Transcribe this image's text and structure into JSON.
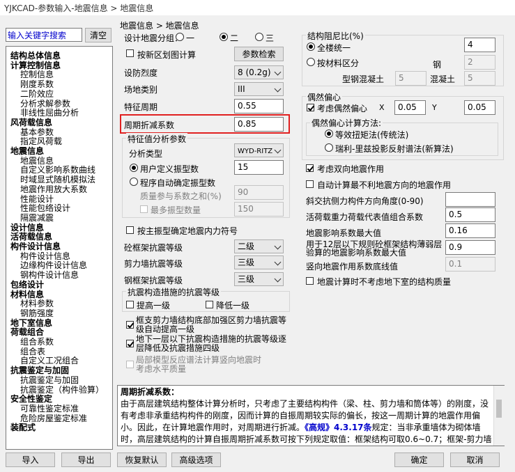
{
  "window": {
    "title": "YJKCAD-参数输入-地震信息 > 地震信息"
  },
  "search": {
    "placeholder": "输入关键字搜索",
    "clear_label": "清空"
  },
  "tree": [
    {
      "label": "结构总体信息",
      "bold": true
    },
    {
      "label": "计算控制信息",
      "bold": true
    },
    {
      "label": "控制信息",
      "bold": false
    },
    {
      "label": "刚度系数",
      "bold": false
    },
    {
      "label": "二阶效应",
      "bold": false
    },
    {
      "label": "分析求解参数",
      "bold": false
    },
    {
      "label": "非线性屈曲分析",
      "bold": false
    },
    {
      "label": "风荷载信息",
      "bold": true
    },
    {
      "label": "基本参数",
      "bold": false
    },
    {
      "label": "指定风荷载",
      "bold": false
    },
    {
      "label": "地震信息",
      "bold": true
    },
    {
      "label": "地震信息",
      "bold": false
    },
    {
      "label": "自定义影响系数曲线",
      "bold": false
    },
    {
      "label": "时域显式随机模拟法",
      "bold": false
    },
    {
      "label": "地震作用放大系数",
      "bold": false
    },
    {
      "label": "性能设计",
      "bold": false
    },
    {
      "label": "性能包络设计",
      "bold": false
    },
    {
      "label": "隔震减震",
      "bold": false
    },
    {
      "label": "设计信息",
      "bold": true
    },
    {
      "label": "活荷载信息",
      "bold": true
    },
    {
      "label": "构件设计信息",
      "bold": true
    },
    {
      "label": "构件设计信息",
      "bold": false
    },
    {
      "label": "边缘构件设计信息",
      "bold": false
    },
    {
      "label": "钢构件设计信息",
      "bold": false
    },
    {
      "label": "包络设计",
      "bold": true
    },
    {
      "label": "材料信息",
      "bold": true
    },
    {
      "label": "材料参数",
      "bold": false
    },
    {
      "label": "钢筋强度",
      "bold": false
    },
    {
      "label": "地下室信息",
      "bold": true
    },
    {
      "label": "荷载组合",
      "bold": true
    },
    {
      "label": "组合系数",
      "bold": false
    },
    {
      "label": "组合表",
      "bold": false
    },
    {
      "label": "自定义工况组合",
      "bold": false
    },
    {
      "label": "抗震鉴定与加固",
      "bold": true
    },
    {
      "label": "抗震鉴定与加固",
      "bold": false
    },
    {
      "label": "抗震鉴定（构件验算）",
      "bold": false
    },
    {
      "label": "安全性鉴定",
      "bold": true
    },
    {
      "label": "可靠性鉴定标准",
      "bold": false
    },
    {
      "label": "危险房屋鉴定标准",
      "bold": false
    },
    {
      "label": "装配式",
      "bold": true
    }
  ],
  "breadcrumb": "地震信息 > 地震信息",
  "left": {
    "design_group_label": "设计地震分组：",
    "group_options": [
      "一",
      "二",
      "三"
    ],
    "group_selected": 1,
    "new_zoning_label": "按新区划图计算",
    "param_check_btn": "参数检索",
    "intensity_label": "设防烈度",
    "intensity_value": "8 (0.2g)",
    "site_label": "场地类别",
    "site_value": "III",
    "period_label": "特征周期",
    "period_value": "0.55",
    "reduction_label": "周期折减系数",
    "reduction_value": "0.85",
    "eigen_group": "特征值分析参数",
    "analysis_type_label": "分析类型",
    "analysis_type_value": "WYD-RITZ",
    "user_modes_label": "用户定义振型数",
    "user_modes_value": "15",
    "auto_modes_label": "程序自动确定振型数",
    "mass_sum_label": "质量参与系数之和(%)",
    "mass_sum_value": "90",
    "max_modes_label": "最多振型数量",
    "max_modes_value": "150",
    "main_mode_label": "按主振型确定地震内力符号",
    "frame_grade_label": "砼框架抗震等级",
    "frame_grade_value": "二级",
    "wall_grade_label": "剪力墙抗震等级",
    "wall_grade_value": "三级",
    "steel_grade_label": "钢框架抗震等级",
    "steel_grade_value": "三级",
    "measure_group": "抗震构造措施的抗震等级",
    "raise_label": "提高一级",
    "lower_label": "降低一级",
    "frame_support_label_1": "框支剪力墙结构底部加强区剪力墙抗震等",
    "frame_support_label_2": "级自动提高一级",
    "basement_label_1": "地下一层以下抗震构造措施的抗震等级逐",
    "basement_label_2": "层降低及抗震措施四级",
    "local_model_label_1": "局部模型反应谱法计算竖向地震时",
    "local_model_label_2": "考虑水平质量"
  },
  "right": {
    "damping_group": "结构阻尼比(%)",
    "uniform_label": "全楼统一",
    "uniform_value": "4",
    "by_material_label": "按材料区分",
    "steel_label": "钢",
    "steel_value": "2",
    "composite_label": "型钢混凝土",
    "composite_value": "5",
    "concrete_label": "混凝土",
    "concrete_value": "5",
    "ecc_group": "偶然偏心",
    "ecc_label": "考虑偶然偏心",
    "x_label": "X",
    "x_value": "0.05",
    "y_label": "Y",
    "y_value": "0.05",
    "ecc_method_group": "偶然偏心计算方法:",
    "method1_label": "等效扭矩法(传统法)",
    "method2_label": "瑞利-里兹投影反射谱法(新算法)",
    "bidirectional_label": "考虑双向地震作用",
    "auto_worst_label": "自动计算最不利地震方向的地震作用",
    "oblique_label": "斜交抗侧力构件方向角度(0-90)",
    "oblique_value": "",
    "live_coef_label": "活荷载重力荷载代表值组合系数",
    "live_coef_value": "0.5",
    "max_influence_label": "地震影响系数最大值",
    "max_influence_value": "0.16",
    "rare_label_1": "用于12层以下规则砼框架结构薄弱层",
    "rare_label_2": "验算的地震影响系数最大值",
    "rare_value": "0.9",
    "vertical_min_label": "竖向地震作用系数底线值",
    "vertical_min_value": "0.1",
    "no_basement_label": "地震计算时不考虑地下室的结构质量"
  },
  "help": {
    "title": "周期折减系数：",
    "line1": "由于高层建筑结构整体计算分析时，只考虑了主要结构构件（梁、柱、剪力墙和筒体等）的刚度，没",
    "line2": "有考虑非承重结构构件的刚度，因而计算的自振周期较实际的偏长，按这一周期计算的地震作用偏",
    "line3_a": "小。因此，在计算地震作用时，对周期进行折减。",
    "line3_b": "《高规》4.3.17条",
    "line3_c": "规定：当非承重墙体为砌体墙",
    "line4": "时，高层建筑结构的计算自振周期折减系数可按下列规定取值：框架结构可取0.6~0.7；框架-剪力墙"
  },
  "bottom": {
    "import": "导入",
    "export": "导出",
    "restore": "恢复默认",
    "advanced": "高级选项",
    "ok": "确定",
    "cancel": "取消"
  }
}
